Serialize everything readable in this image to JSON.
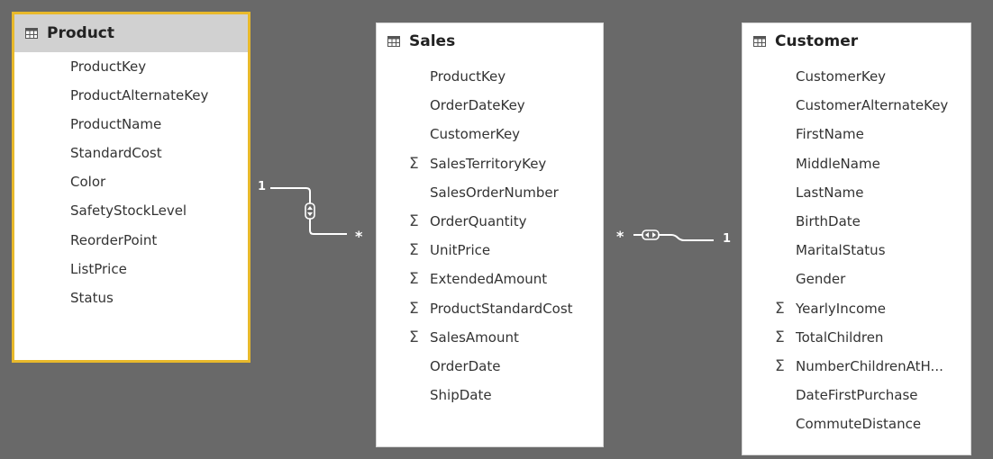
{
  "tables": {
    "product": {
      "title": "Product",
      "fields": [
        {
          "name": "ProductKey",
          "aggregate": ""
        },
        {
          "name": "ProductAlternateKey",
          "aggregate": ""
        },
        {
          "name": "ProductName",
          "aggregate": ""
        },
        {
          "name": "StandardCost",
          "aggregate": ""
        },
        {
          "name": "Color",
          "aggregate": ""
        },
        {
          "name": "SafetyStockLevel",
          "aggregate": ""
        },
        {
          "name": "ReorderPoint",
          "aggregate": ""
        },
        {
          "name": "ListPrice",
          "aggregate": ""
        },
        {
          "name": "Status",
          "aggregate": ""
        }
      ]
    },
    "sales": {
      "title": "Sales",
      "fields": [
        {
          "name": "ProductKey",
          "aggregate": ""
        },
        {
          "name": "OrderDateKey",
          "aggregate": ""
        },
        {
          "name": "CustomerKey",
          "aggregate": ""
        },
        {
          "name": "SalesTerritoryKey",
          "aggregate": "Σ"
        },
        {
          "name": "SalesOrderNumber",
          "aggregate": ""
        },
        {
          "name": "OrderQuantity",
          "aggregate": "Σ"
        },
        {
          "name": "UnitPrice",
          "aggregate": "Σ"
        },
        {
          "name": "ExtendedAmount",
          "aggregate": "Σ"
        },
        {
          "name": "ProductStandardCost",
          "aggregate": "Σ"
        },
        {
          "name": "SalesAmount",
          "aggregate": "Σ"
        },
        {
          "name": "OrderDate",
          "aggregate": ""
        },
        {
          "name": "ShipDate",
          "aggregate": ""
        }
      ]
    },
    "customer": {
      "title": "Customer",
      "fields": [
        {
          "name": "CustomerKey",
          "aggregate": ""
        },
        {
          "name": "CustomerAlternateKey",
          "aggregate": ""
        },
        {
          "name": "FirstName",
          "aggregate": ""
        },
        {
          "name": "MiddleName",
          "aggregate": ""
        },
        {
          "name": "LastName",
          "aggregate": ""
        },
        {
          "name": "BirthDate",
          "aggregate": ""
        },
        {
          "name": "MaritalStatus",
          "aggregate": ""
        },
        {
          "name": "Gender",
          "aggregate": ""
        },
        {
          "name": "YearlyIncome",
          "aggregate": "Σ"
        },
        {
          "name": "TotalChildren",
          "aggregate": "Σ"
        },
        {
          "name": "NumberChildrenAtH...",
          "aggregate": "Σ"
        },
        {
          "name": "DateFirstPurchase",
          "aggregate": ""
        },
        {
          "name": "CommuteDistance",
          "aggregate": ""
        }
      ]
    }
  },
  "relationships": {
    "product_sales": {
      "from_cardinality": "1",
      "to_cardinality": "*"
    },
    "sales_customer": {
      "from_cardinality": "*",
      "to_cardinality": "1"
    }
  },
  "colors": {
    "canvas": "#696969",
    "selection_border": "#e8b92b",
    "header_selected": "#d1d1d1",
    "relationship_line": "#ffffff"
  },
  "icons": {
    "table": "table-icon",
    "sigma": "sigma-icon",
    "bidirectional": "bidirectional-filter-icon"
  }
}
